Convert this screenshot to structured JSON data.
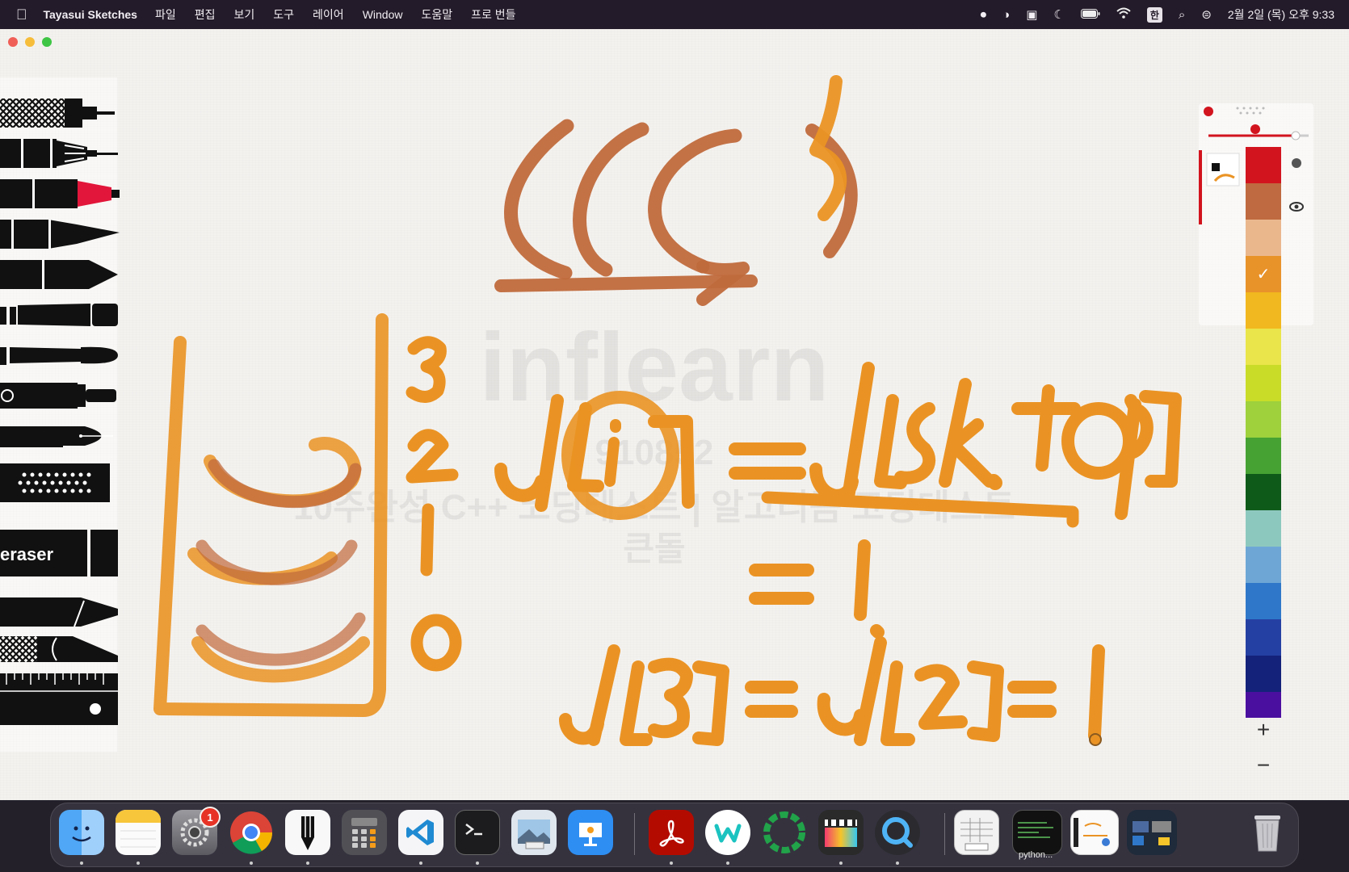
{
  "menubar": {
    "apple_icon": "",
    "app_name": "Tayasui Sketches",
    "menus": [
      "파일",
      "편집",
      "보기",
      "도구",
      "레이어",
      "Window",
      "도움말",
      "프로 번들"
    ],
    "status_icons": [
      "record-icon",
      "sync-icon",
      "display-icon",
      "moon-icon",
      "battery-icon",
      "wifi-icon"
    ],
    "input_source": "한",
    "clock": "2월 2일 (목) 오후 9:33"
  },
  "tools": {
    "eraser_label": "eraser",
    "items": [
      "crosshatch-pencil",
      "mechanical-pencil",
      "felt-pen",
      "brush-pen",
      "marker",
      "airbrush",
      "ink-brush",
      "round-brush",
      "fountain-pen",
      "spray-dots",
      "eraser",
      "cutter",
      "pattern-brush",
      "ruler"
    ]
  },
  "watermark": {
    "brand": "inflearn",
    "code": "910852",
    "course": "10주완성 C++ 코딩테스트 | 알고리즘 코딩테스트",
    "author": "큰돌"
  },
  "canvas": {
    "ink_orange": "#ea9324",
    "ink_brown": "#c06a3c"
  },
  "palette": {
    "selected_color": "#e8922a",
    "swatches": [
      "#d2141e",
      "#bf6a40",
      "#eab78d",
      "#e8922a",
      "#f2b81f",
      "#e9e54a",
      "#c8dc28",
      "#9ed13c",
      "#46a233",
      "#0e5b19",
      "#8dc8be",
      "#6ea7d6",
      "#2f78c9",
      "#2540a3",
      "#15227a",
      "#4b0fa0"
    ],
    "selected_index": 3,
    "check_mark": "✓",
    "zoom_in": "+",
    "zoom_out": "−"
  },
  "dock": {
    "settings_badge": "1",
    "terminal_caption": "python...",
    "apps": [
      "Finder",
      "Notes",
      "System Settings",
      "Chrome",
      "Tayasui Sketches",
      "Calculator",
      "VS Code",
      "Terminal",
      "Preview",
      "Keynote",
      "Acrobat",
      "Whale",
      "Sync",
      "Final Cut Pro",
      "QuickTime",
      "Excel File",
      "Terminal Window",
      "Sketch Window",
      "Desktop Window",
      "Trash"
    ]
  }
}
